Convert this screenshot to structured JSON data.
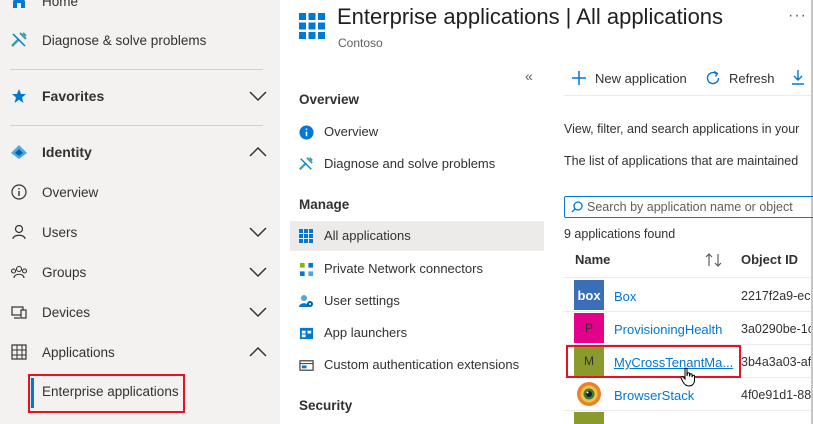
{
  "left_nav": {
    "items": [
      {
        "label": "Home",
        "icon": "home-icon"
      },
      {
        "label": "Diagnose & solve problems",
        "icon": "wrench-icon"
      },
      {
        "label": "Favorites",
        "icon": "star-icon"
      },
      {
        "label": "Identity",
        "icon": "identity-icon"
      },
      {
        "label": "Overview",
        "icon": "info-icon"
      },
      {
        "label": "Users",
        "icon": "user-icon"
      },
      {
        "label": "Groups",
        "icon": "groups-icon"
      },
      {
        "label": "Devices",
        "icon": "devices-icon"
      },
      {
        "label": "Applications",
        "icon": "applications-icon"
      },
      {
        "label": "Enterprise applications"
      }
    ]
  },
  "header": {
    "title": "Enterprise applications | All applications",
    "subtitle": "Contoso",
    "more": "···",
    "close": "×"
  },
  "middle_menu": {
    "collapse": "«",
    "sections": {
      "overview": "Overview",
      "manage": "Manage",
      "security": "Security"
    },
    "items": [
      {
        "label": "Overview",
        "icon": "info-icon"
      },
      {
        "label": "Diagnose and solve problems",
        "icon": "wrench-icon"
      },
      {
        "label": "All applications",
        "icon": "grid-icon",
        "selected": true
      },
      {
        "label": "Private Network connectors",
        "icon": "connectors-icon"
      },
      {
        "label": "User settings",
        "icon": "user-settings-icon"
      },
      {
        "label": "App launchers",
        "icon": "app-launchers-icon"
      },
      {
        "label": "Custom authentication extensions",
        "icon": "extension-icon"
      }
    ]
  },
  "toolbar": {
    "new_application": "New application",
    "refresh": "Refresh"
  },
  "content": {
    "intro": "View, filter, and search applications in your",
    "description": "The list of applications that are maintained",
    "search_placeholder": "Search by application name or object",
    "found": "9 applications found"
  },
  "table": {
    "headers": {
      "name": "Name",
      "object_id": "Object ID"
    },
    "rows": [
      {
        "logo_text": "box",
        "logo_color": "#3a6fb8",
        "name": "Box",
        "object_id": "2217f2a9-ec"
      },
      {
        "logo_text": "P",
        "logo_color": "#e3008c",
        "name": "ProvisioningHealth",
        "object_id": "3a0290be-1c"
      },
      {
        "logo_text": "M",
        "logo_color": "#8a9a2c",
        "name": "MyCrossTenantMa...",
        "object_id": "3b4a3a03-af"
      },
      {
        "logo_text": "",
        "logo_color": "#5a6b2a",
        "name": "BrowserStack",
        "object_id": "4f0e91d1-88"
      }
    ]
  },
  "colors": {
    "accent": "#0078d4",
    "highlight": "#e81123",
    "nav_bg": "#f3f2f1"
  }
}
